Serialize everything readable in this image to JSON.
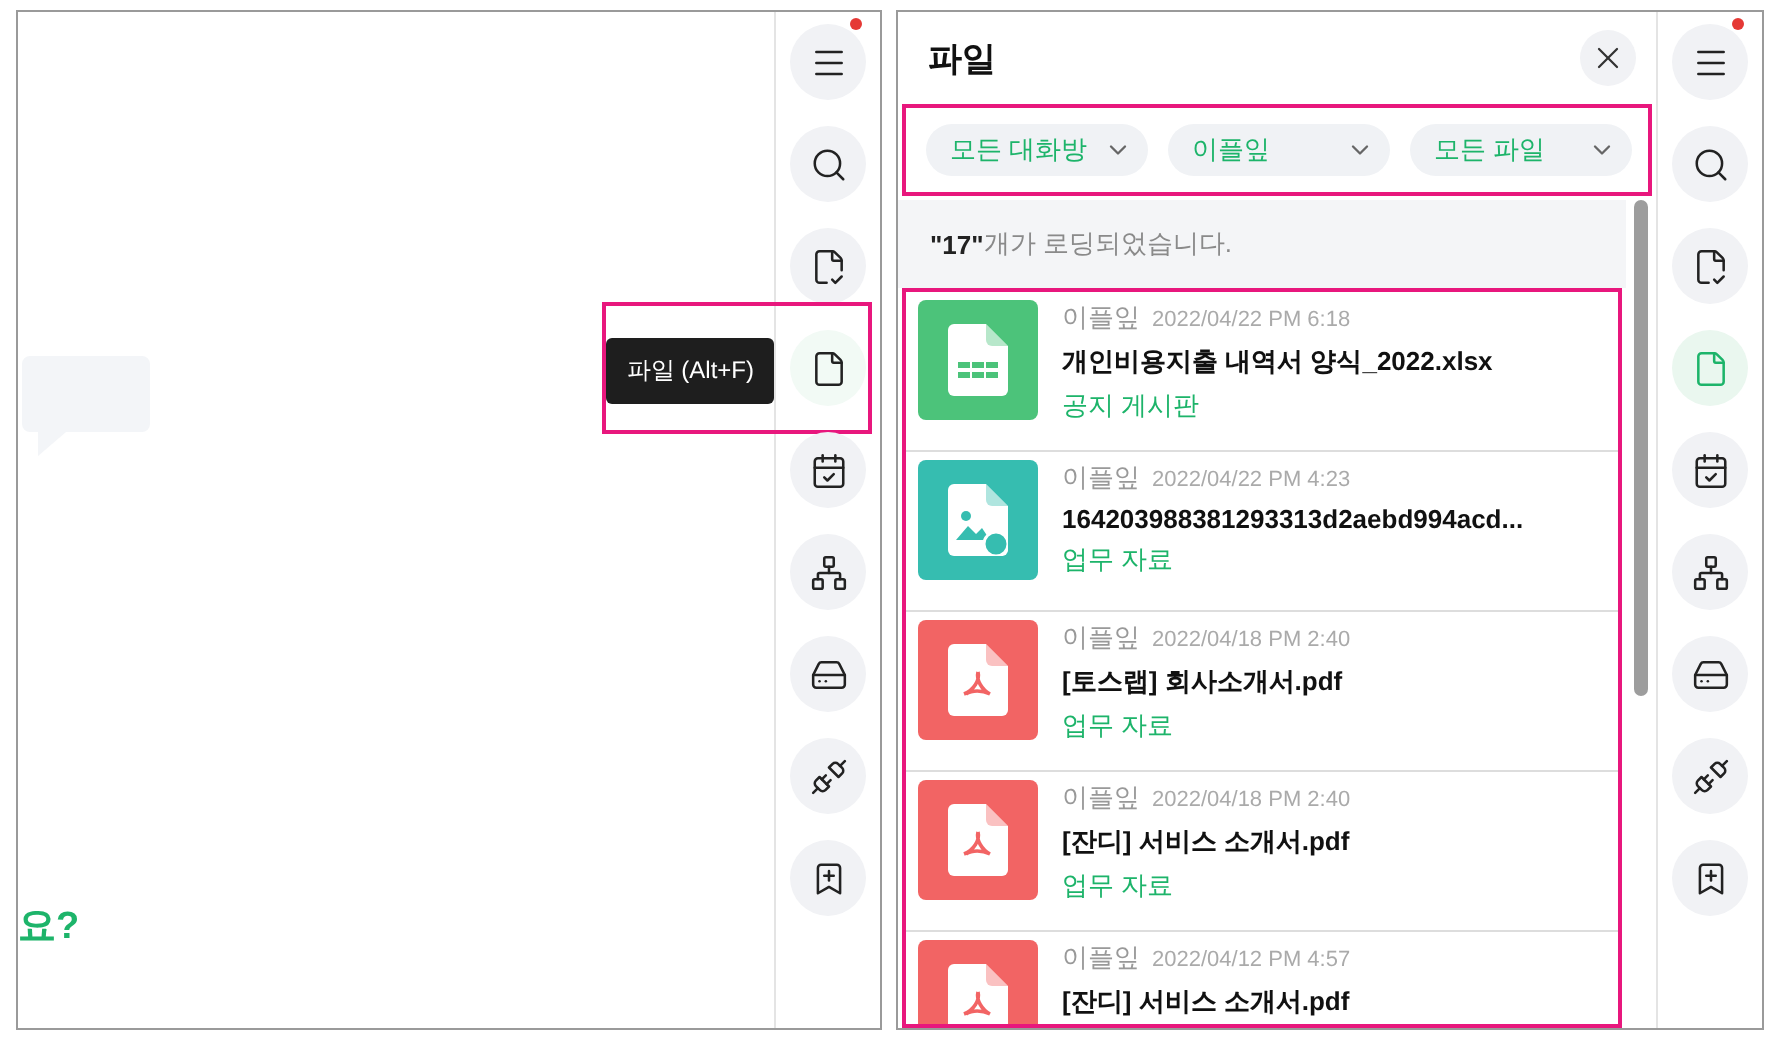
{
  "left_panel": {
    "main_text": "요?",
    "sidebar": [
      {
        "kind": "menu",
        "selected": false,
        "notification": true
      },
      {
        "kind": "search",
        "selected": false,
        "notification": false
      },
      {
        "kind": "tasks",
        "selected": false,
        "notification": false
      },
      {
        "kind": "file",
        "selected": false,
        "notification": false,
        "tooltip": "파일 (Alt+F)",
        "highlighted": true
      },
      {
        "kind": "calendar",
        "selected": false,
        "notification": false
      },
      {
        "kind": "org",
        "selected": false,
        "notification": false
      },
      {
        "kind": "drive",
        "selected": false,
        "notification": false
      },
      {
        "kind": "connect",
        "selected": false,
        "notification": false
      },
      {
        "kind": "bookmark",
        "selected": false,
        "notification": false
      }
    ]
  },
  "right_panel": {
    "title": "파일",
    "filters": {
      "highlighted": true,
      "items": [
        "모든 대화방",
        "이플잎",
        "모든 파일"
      ]
    },
    "status": "**\"17\"**개가 로딩되었습니다.",
    "list": {
      "highlighted": true,
      "items": [
        {
          "kind": "xlsx",
          "author": "이플잎",
          "time": "2022/04/22 PM 6:18",
          "name": "개인비용지출 내역서 양식_2022.xlsx",
          "category": "공지 게시판"
        },
        {
          "kind": "image",
          "author": "이플잎",
          "time": "2022/04/22 PM 4:23",
          "name": "164203988381293313d2aebd994acd...",
          "category": "업무 자료"
        },
        {
          "kind": "pdf",
          "author": "이플잎",
          "time": "2022/04/18 PM 2:40",
          "name": "[토스랩] 회사소개서.pdf",
          "category": "업무 자료"
        },
        {
          "kind": "pdf",
          "author": "이플잎",
          "time": "2022/04/18 PM 2:40",
          "name": "[잔디] 서비스 소개서.pdf",
          "category": "업무 자료"
        },
        {
          "kind": "pdf",
          "author": "이플잎",
          "time": "2022/04/12 PM 4:57",
          "name": "[잔디] 서비스 소개서.pdf"
        }
      ]
    },
    "sidebar": [
      {
        "kind": "menu",
        "selected": false,
        "notification": true
      },
      {
        "kind": "search",
        "selected": false,
        "notification": false
      },
      {
        "kind": "tasks",
        "selected": false,
        "notification": false
      },
      {
        "kind": "file",
        "selected": true,
        "notification": false
      },
      {
        "kind": "calendar",
        "selected": false,
        "notification": false
      },
      {
        "kind": "org",
        "selected": false,
        "notification": false
      },
      {
        "kind": "drive",
        "selected": false,
        "notification": false
      },
      {
        "kind": "connect",
        "selected": false,
        "notification": false
      },
      {
        "kind": "bookmark",
        "selected": false,
        "notification": false
      }
    ]
  }
}
